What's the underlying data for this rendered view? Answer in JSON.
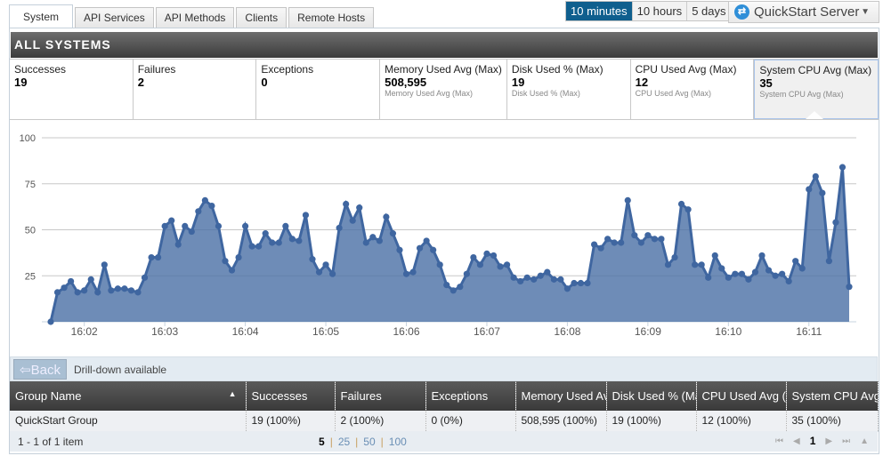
{
  "tabs": [
    {
      "label": "System",
      "active": true
    },
    {
      "label": "API Services"
    },
    {
      "label": "API Methods"
    },
    {
      "label": "Clients"
    },
    {
      "label": "Remote Hosts"
    }
  ],
  "time_range": {
    "options": [
      "10 minutes",
      "10 hours",
      "5 days"
    ],
    "selected": "10 minutes"
  },
  "server_select": {
    "value": "QuickStart Server",
    "icon": "swap-arrows-icon"
  },
  "panel_title": "ALL SYSTEMS",
  "summary": [
    {
      "title": "Successes",
      "value": "19",
      "sub": ""
    },
    {
      "title": "Failures",
      "value": "2",
      "sub": ""
    },
    {
      "title": "Exceptions",
      "value": "0",
      "sub": ""
    },
    {
      "title": "Memory Used Avg (Max)",
      "value": "508,595",
      "sub": "Memory Used Avg (Max)"
    },
    {
      "title": "Disk Used % (Max)",
      "value": "19",
      "sub": "Disk Used % (Max)"
    },
    {
      "title": "CPU Used Avg (Max)",
      "value": "12",
      "sub": "CPU Used Avg (Max)"
    },
    {
      "title": "System CPU Avg (Max)",
      "value": "35",
      "sub": "System CPU Avg (Max)",
      "selected": true
    }
  ],
  "chart_data": {
    "type": "area",
    "title": "System CPU Avg (Max)",
    "x_start": "16:01:35",
    "interval_seconds": 5,
    "x_ticks": [
      "16:02",
      "16:03",
      "16:04",
      "16:05",
      "16:06",
      "16:07",
      "16:08",
      "16:09",
      "16:10",
      "16:11"
    ],
    "y_ticks": [
      "100",
      "75",
      "50",
      "25"
    ],
    "ylim": [
      0,
      100
    ],
    "grid": true,
    "color": "#4a6fa5",
    "values": [
      0,
      16,
      18.5,
      22,
      16,
      17,
      23,
      16,
      31,
      17,
      18,
      18,
      17,
      16,
      24,
      35,
      35,
      52,
      55,
      42,
      52,
      49,
      60,
      66,
      63,
      52,
      33,
      28,
      35,
      52,
      41,
      41,
      48,
      43,
      43,
      52,
      45,
      44,
      58,
      34,
      27,
      31,
      26,
      51,
      64,
      55,
      62,
      43,
      46,
      44,
      57,
      48,
      39,
      26,
      27,
      40,
      44,
      39,
      31,
      20,
      17,
      19,
      26,
      35,
      31,
      37,
      36,
      30,
      31,
      24,
      22,
      24,
      23,
      25,
      27,
      23,
      23,
      18,
      21,
      21,
      21,
      42,
      40,
      45,
      43,
      43,
      66,
      47,
      43,
      47,
      45,
      45,
      31,
      35,
      64,
      61,
      31,
      31,
      24,
      36,
      29,
      24,
      26,
      26,
      23,
      27,
      36,
      28,
      25,
      26,
      22,
      33,
      29,
      72,
      79,
      70,
      33,
      54,
      84,
      19
    ]
  },
  "drill": {
    "back_label": "Back",
    "hint": "Drill-down available"
  },
  "table": {
    "columns": [
      "Group Name",
      "Successes",
      "Failures",
      "Exceptions",
      "Memory Used Avg (Max)",
      "Disk Used % (Max)",
      "CPU Used Avg (Max)",
      "System CPU Avg (Max)"
    ],
    "rows": [
      [
        "QuickStart Group",
        "19 (100%)",
        "2 (100%)",
        "0 (0%)",
        "508,595 (100%)",
        "19 (100%)",
        "12 (100%)",
        "35 (100%)"
      ]
    ]
  },
  "footer": {
    "info": "1 - 1 of 1 item",
    "page_sizes": [
      "5",
      "25",
      "50",
      "100"
    ],
    "current_page": "1"
  }
}
